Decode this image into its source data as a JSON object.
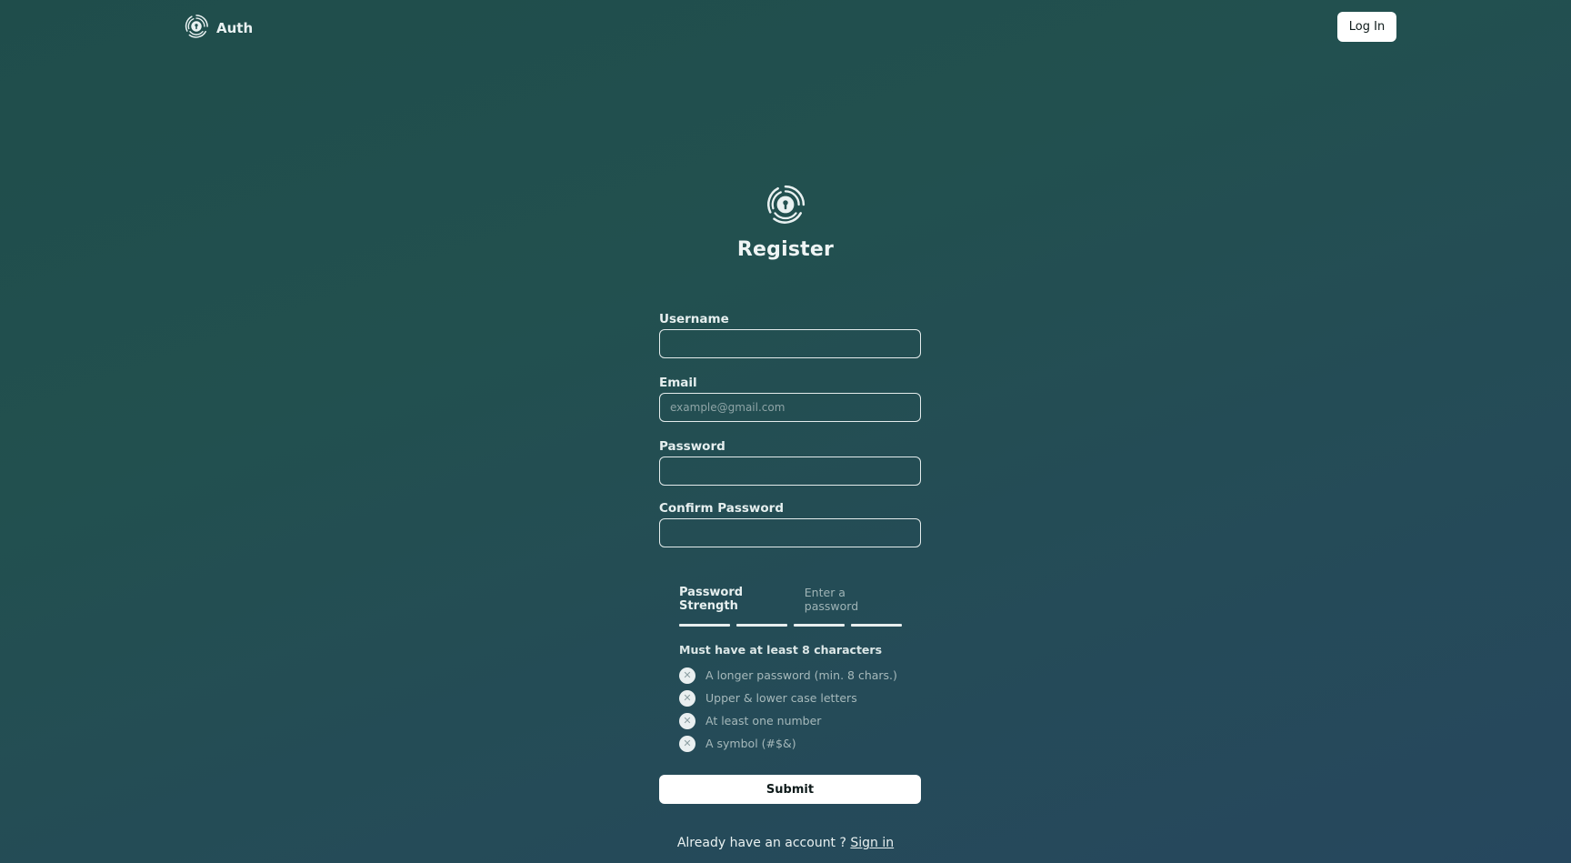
{
  "header": {
    "brand_name": "Auth",
    "brand_icon": "fingerprint-lock-logo-icon",
    "login_label": "Log In"
  },
  "hero": {
    "logo_icon": "fingerprint-lock-logo-icon",
    "title": "Register"
  },
  "form": {
    "username": {
      "label": "Username",
      "value": "",
      "placeholder": ""
    },
    "email": {
      "label": "Email",
      "value": "",
      "placeholder": "example@gmail.com"
    },
    "password": {
      "label": "Password",
      "value": "",
      "placeholder": ""
    },
    "confirm_password": {
      "label": "Confirm Password",
      "value": "",
      "placeholder": ""
    }
  },
  "strength": {
    "title": "Password Strength",
    "status": "Enter a password",
    "level": 0,
    "requirements_title": "Must have at least 8 characters",
    "requirements": [
      {
        "icon": "x-icon",
        "label": "A longer password (min. 8 chars.)"
      },
      {
        "icon": "x-icon",
        "label": "Upper & lower case letters"
      },
      {
        "icon": "x-icon",
        "label": "At least one number"
      },
      {
        "icon": "x-icon",
        "label": "A symbol (#$&)"
      }
    ]
  },
  "submit_label": "Submit",
  "footer": {
    "prompt": "Already have an account ?",
    "link_label": "Sign in"
  }
}
